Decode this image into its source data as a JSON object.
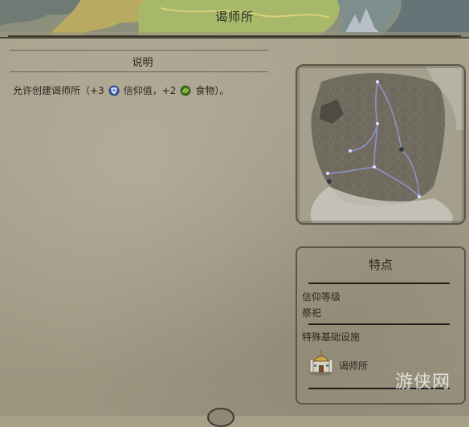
{
  "window": {
    "title": "谒师所"
  },
  "description": {
    "header": "说明",
    "text_prefix": "允许创建谒师所（+3",
    "faith_label": "信仰值，+2",
    "food_label": "食物）。",
    "faith_icon": "faith-icon",
    "food_icon": "food-icon"
  },
  "features": {
    "title": "特点",
    "faith_level_label": "信仰等级",
    "faith_level_value": "祭祀",
    "special_infra_label": "特殊基础设施",
    "building_name": "谒师所",
    "building_icon": "shrine-building-icon"
  },
  "watermark": "游侠网",
  "colors": {
    "parchment": "#a79f8a",
    "faith_blue": "#5b84c4",
    "food_green": "#7fb43a",
    "map_route": "#8d98d8"
  }
}
